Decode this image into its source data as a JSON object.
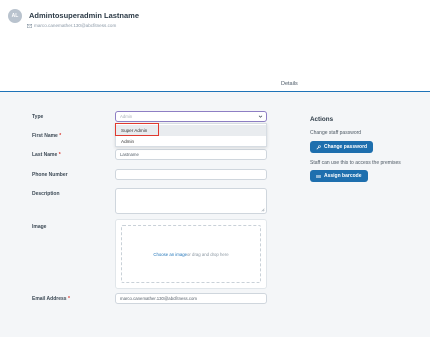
{
  "user": {
    "initials": "AL",
    "name": "Admintosuperadmin Lastname",
    "email": "marco.canemather.130@abcfitness.com"
  },
  "tabs": {
    "active": "Details"
  },
  "form": {
    "type": {
      "label": "Type",
      "placeholder": "Admin"
    },
    "type_options": [
      "Super Admin",
      "Admin"
    ],
    "first_name": {
      "label": "First Name",
      "required_mark": "*",
      "value": ""
    },
    "last_name": {
      "label": "Last Name",
      "required_mark": "*",
      "value": "Lastname"
    },
    "phone": {
      "label": "Phone Number",
      "value": ""
    },
    "description": {
      "label": "Description",
      "value": ""
    },
    "image": {
      "label": "Image",
      "link_text": "Choose an image",
      "rest_text": " or drag and drop here"
    },
    "email": {
      "label": "Email Address",
      "required_mark": "*",
      "value": "marco.canemather.130@abcfitness.com"
    }
  },
  "actions": {
    "title": "Actions",
    "password_text": "Change staff password",
    "password_button": "Change password",
    "barcode_text": "Staff can use this to access the premises",
    "barcode_button": "Assign barcode"
  },
  "colors": {
    "accent": "#1e6fae",
    "tab_underline": "#1e73b8",
    "highlight": "#e0392f",
    "required": "#d9342b"
  }
}
